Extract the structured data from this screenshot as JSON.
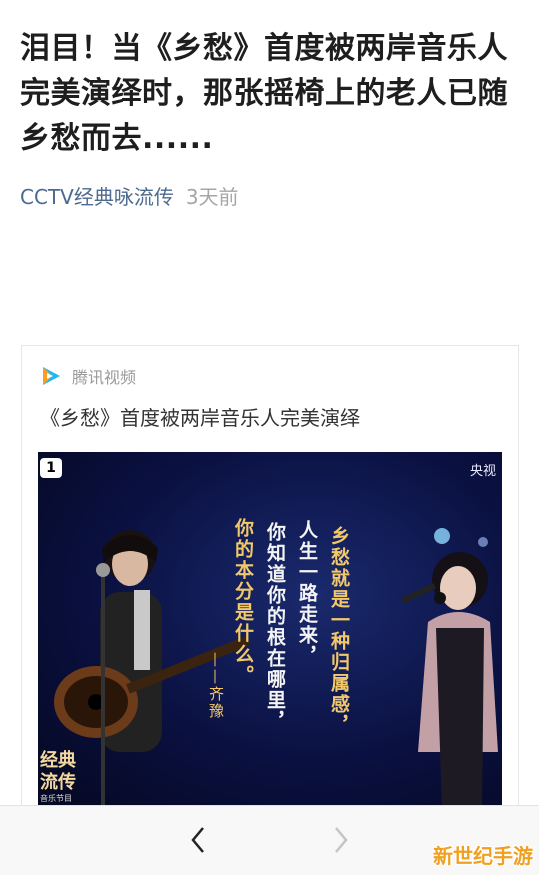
{
  "article": {
    "headline": "泪目！当《乡愁》首度被两岸音乐人完美演绎时，那张摇椅上的老人已随乡愁而去......",
    "source": "CCTV经典咏流传",
    "time": "3天前"
  },
  "card": {
    "source_name": "腾讯视频",
    "title": "《乡愁》首度被两岸音乐人完美演绎",
    "video": {
      "badge": "1",
      "channel": "央视",
      "show_title": "经典\n流传",
      "show_subtitle": "音乐节目",
      "poem": {
        "col1": "乡愁就是一种归属感，",
        "col2": "人生一路走来，",
        "col3": "你知道你的根在哪里，",
        "col4": "你的本分是什么。",
        "author": "——齐豫"
      }
    }
  },
  "nav": {
    "back_icon": "chevron-left-icon",
    "forward_icon": "chevron-right-icon"
  },
  "watermark": "新世纪手游"
}
